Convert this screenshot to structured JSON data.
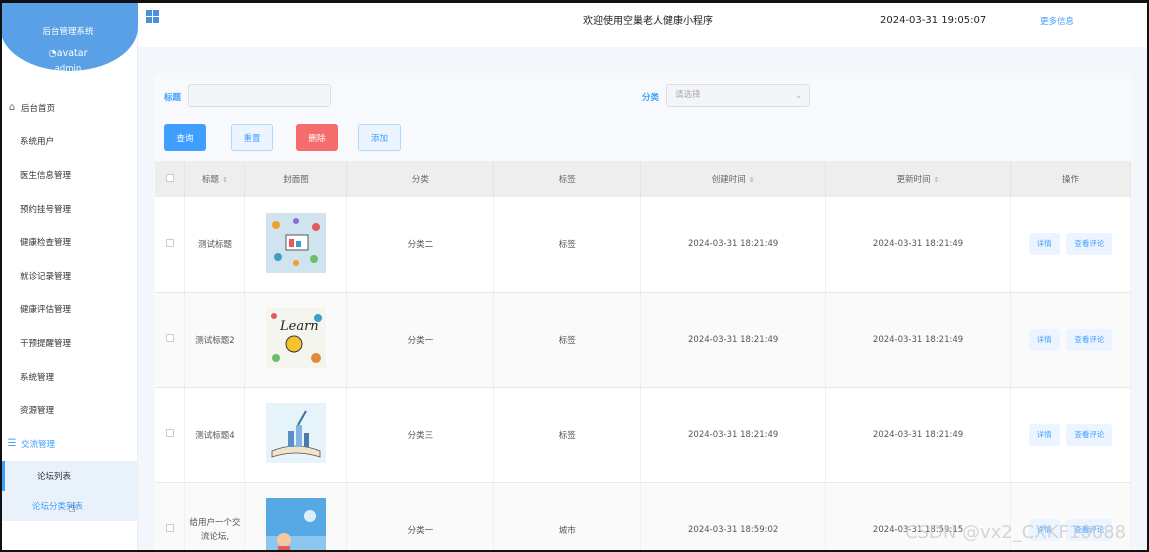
{
  "sidebar": {
    "brand_title": "后台管理系统",
    "avatar_alt": "avatar",
    "username": "admin",
    "menu": [
      {
        "label": "后台首页",
        "icon": "home-icon"
      },
      {
        "label": "系统用户"
      },
      {
        "label": "医生信息管理"
      },
      {
        "label": "预约挂号管理"
      },
      {
        "label": "健康检查管理"
      },
      {
        "label": "就诊记录管理"
      },
      {
        "label": "健康评估管理"
      },
      {
        "label": "干预提醒管理"
      },
      {
        "label": "系统管理"
      },
      {
        "label": "资源管理"
      },
      {
        "label": "交流管理",
        "icon": "list-icon"
      }
    ],
    "submenu": [
      {
        "label": "论坛列表"
      },
      {
        "label": "论坛分类列表"
      }
    ]
  },
  "header": {
    "welcome": "欢迎使用空巢老人健康小程序",
    "datetime": "2024-03-31 19:05:07",
    "more": "更多信息"
  },
  "search": {
    "title_label": "标题",
    "title_value": "",
    "category_label": "分类",
    "category_placeholder": "请选择"
  },
  "actions": {
    "query": "查询",
    "reset": "重置",
    "delete": "删除",
    "add": "添加"
  },
  "table": {
    "headers": [
      "标题",
      "封面图",
      "分类",
      "标签",
      "创建时间",
      "更新时间",
      "操作"
    ],
    "rows": [
      {
        "title": "测试标题",
        "cover": "cover-image-1",
        "category": "分类二",
        "tag": "标签",
        "created": "2024-03-31 18:21:49",
        "updated": "2024-03-31 18:21:49"
      },
      {
        "title": "测试标题2",
        "cover": "cover-image-2",
        "category": "分类一",
        "tag": "标签",
        "created": "2024-03-31 18:21:49",
        "updated": "2024-03-31 18:21:49"
      },
      {
        "title": "测试标题4",
        "cover": "cover-image-3",
        "category": "分类三",
        "tag": "标签",
        "created": "2024-03-31 18:21:49",
        "updated": "2024-03-31 18:21:49"
      },
      {
        "title": "给用户一个交流论坛,",
        "cover": "cover-image-4",
        "category": "分类一",
        "tag": "城市",
        "created": "2024-03-31 18:59:02",
        "updated": "2024-03-31 18:59:15"
      }
    ],
    "row_actions": {
      "detail": "详情",
      "comments": "查看评论"
    }
  },
  "watermark": "CSDN @vx2_CXKF10088",
  "colors": {
    "accent": "#409eff",
    "brand": "#5aa0e6",
    "danger": "#f56c6c"
  }
}
